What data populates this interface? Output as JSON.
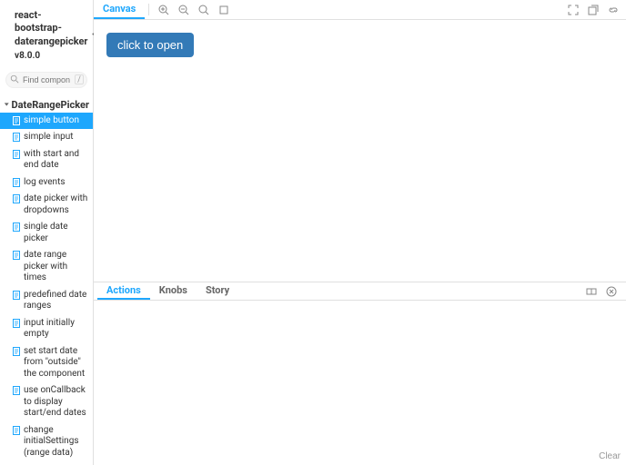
{
  "brand": {
    "title_line1": "react-bootstrap-",
    "title_line2": "daterangepicker",
    "version": "v8.0.0"
  },
  "search": {
    "placeholder": "Find components",
    "slash": "/"
  },
  "group": {
    "label": "DateRangePicker"
  },
  "stories": [
    {
      "label": "simple button",
      "selected": true
    },
    {
      "label": "simple input"
    },
    {
      "label": "with start and end date"
    },
    {
      "label": "log events"
    },
    {
      "label": "date picker with dropdowns"
    },
    {
      "label": "single date picker"
    },
    {
      "label": "date range picker with times"
    },
    {
      "label": "predefined date ranges"
    },
    {
      "label": "input initially empty"
    },
    {
      "label": "set start date from \"outside\" the component"
    },
    {
      "label": "use onCallback to display start/end dates"
    },
    {
      "label": "change initialSettings (range data)"
    }
  ],
  "tabs": {
    "canvas": "Canvas"
  },
  "demo": {
    "button_label": "click to open"
  },
  "addons": {
    "tabs": {
      "actions": "Actions",
      "knobs": "Knobs",
      "story": "Story"
    },
    "clear": "Clear"
  }
}
